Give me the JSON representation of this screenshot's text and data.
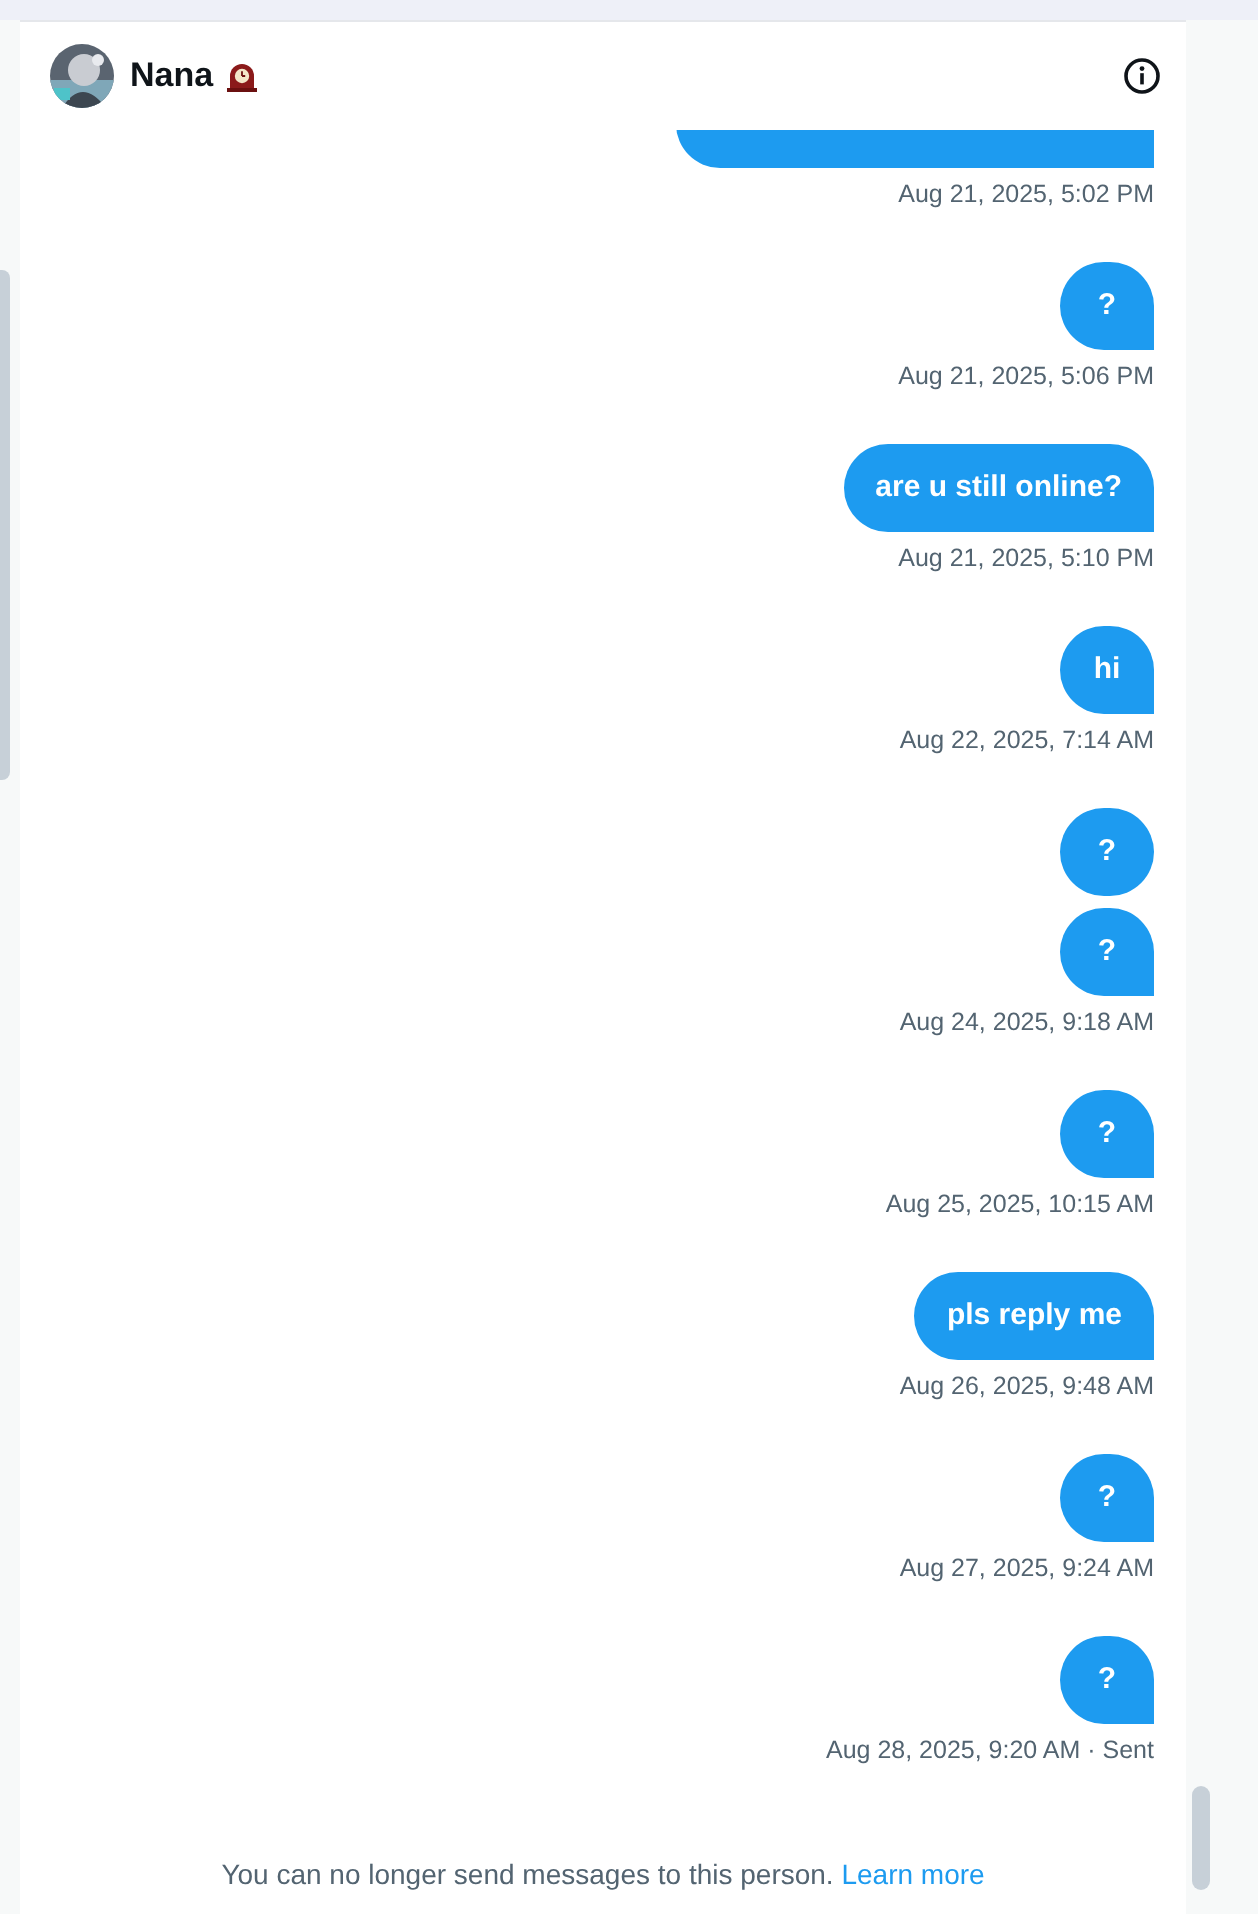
{
  "header": {
    "name": "Nana"
  },
  "messages": [
    {
      "covered_bubble": true,
      "time": "Aug 21, 2025, 5:02 PM"
    },
    {
      "bubbles": [
        "?"
      ],
      "time": "Aug 21, 2025, 5:06 PM"
    },
    {
      "bubbles": [
        "are u still online?"
      ],
      "time": "Aug 21, 2025, 5:10 PM"
    },
    {
      "bubbles": [
        "hi"
      ],
      "time": "Aug 22, 2025, 7:14 AM"
    },
    {
      "bubbles": [
        "?",
        "?"
      ],
      "time": "Aug 24, 2025, 9:18 AM"
    },
    {
      "bubbles": [
        "?"
      ],
      "time": "Aug 25, 2025, 10:15 AM"
    },
    {
      "bubbles": [
        "pls reply me"
      ],
      "time": "Aug 26, 2025, 9:48 AM"
    },
    {
      "bubbles": [
        "?"
      ],
      "time": "Aug 27, 2025, 9:24 AM"
    },
    {
      "bubbles": [
        "?"
      ],
      "time": "Aug 28, 2025, 9:20 AM · Sent"
    }
  ],
  "footer": {
    "notice": "You can no longer send messages to this person.",
    "link": "Learn more"
  }
}
